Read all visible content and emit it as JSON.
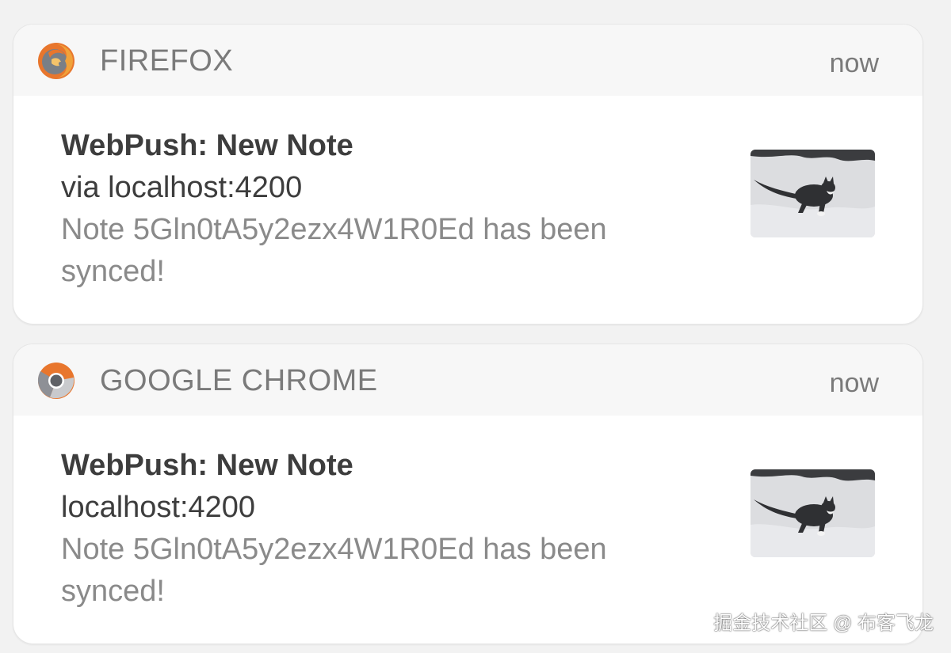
{
  "notifications": [
    {
      "app_name": "FIREFOX",
      "icon": "firefox-icon",
      "timestamp": "now",
      "title": "WebPush: New Note",
      "subtitle": "via localhost:4200",
      "message": "Note 5Gln0tA5y2ezx4W1R0Ed has been synced!",
      "thumbnail": "cat-in-snow-thumbnail"
    },
    {
      "app_name": "GOOGLE CHROME",
      "icon": "chrome-icon",
      "timestamp": "now",
      "title": "WebPush: New Note",
      "subtitle": "localhost:4200",
      "message": "Note 5Gln0tA5y2ezx4W1R0Ed has been synced!",
      "thumbnail": "cat-in-snow-thumbnail"
    }
  ],
  "watermark": "掘金技术社区 @ 布客飞龙",
  "colors": {
    "background": "#f2f2f2",
    "card": "#ffffff",
    "header": "#f7f7f7",
    "app_name_text": "#7a7a7a",
    "title_text": "#3d3d3d",
    "message_text": "#8a8a8a"
  }
}
